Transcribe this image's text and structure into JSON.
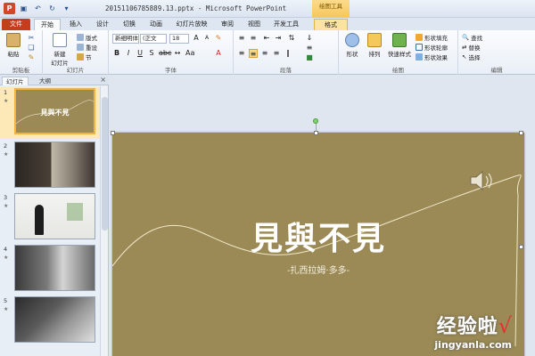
{
  "window": {
    "doc_title": "20151106785889.13.pptx - Microsoft PowerPoint",
    "context_group": "绘图工具"
  },
  "tabs": [
    {
      "label": "文件"
    },
    {
      "label": "开始"
    },
    {
      "label": "插入"
    },
    {
      "label": "设计"
    },
    {
      "label": "切换"
    },
    {
      "label": "动画"
    },
    {
      "label": "幻灯片放映"
    },
    {
      "label": "审阅"
    },
    {
      "label": "视图"
    },
    {
      "label": "开发工具"
    },
    {
      "label": "格式"
    }
  ],
  "ribbon": {
    "clipboard": {
      "label": "剪贴板",
      "paste": "粘贴"
    },
    "slides": {
      "label": "幻灯片",
      "new_slide": "新建\n幻灯片",
      "layout": "版式",
      "reset": "重设",
      "section": "节"
    },
    "font": {
      "label": "字体",
      "font_name": "新细明体",
      "font_name2": "(正文",
      "size": "18"
    },
    "paragraph": {
      "label": "段落"
    },
    "drawing": {
      "label": "绘图",
      "shapes": "形状",
      "arrange": "排列",
      "quick_styles": "快速样式",
      "fill": "形状填充",
      "outline": "形状轮廓",
      "effects": "形状效果"
    },
    "editing": {
      "label": "编辑",
      "find": "查找",
      "replace": "替换",
      "select": "选择"
    }
  },
  "left_panel": {
    "tab_slides": "幻灯片",
    "tab_outline": "大纲",
    "close": "×",
    "slides": [
      {
        "num": "1",
        "title": "見與不見"
      },
      {
        "num": "2"
      },
      {
        "num": "3"
      },
      {
        "num": "4"
      },
      {
        "num": "5"
      }
    ]
  },
  "slide": {
    "title": "見與不見",
    "subtitle": "-扎西拉姆·多多-"
  },
  "watermark": {
    "brand": "经验啦",
    "check": "√",
    "url": "jingyanla.com"
  },
  "colors": {
    "slide_bg": "#9b8a55",
    "file_tab": "#c43e1c",
    "selected_thumb": "#f2b33d"
  }
}
